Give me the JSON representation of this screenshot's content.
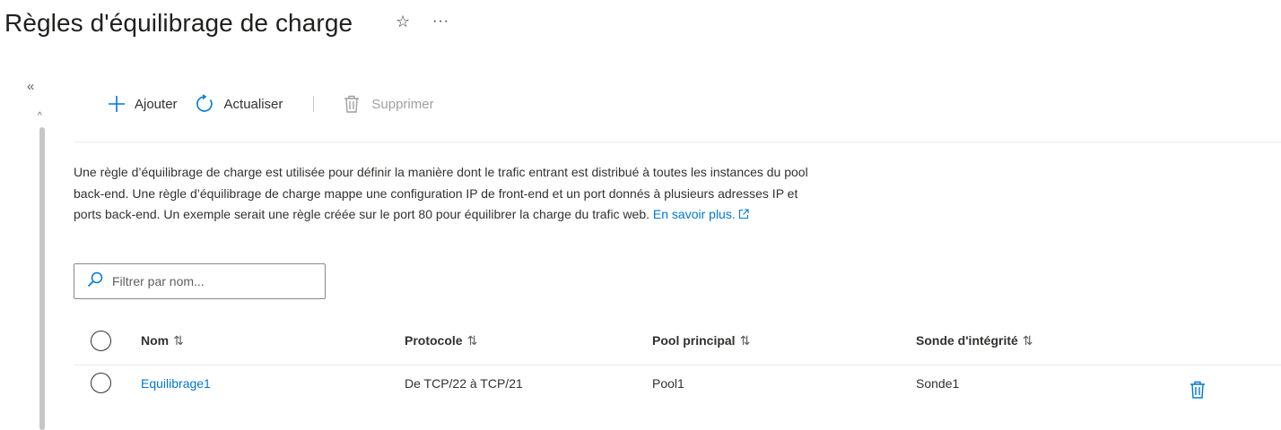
{
  "header": {
    "title": "Règles d'équilibrage de charge",
    "favorite_icon": "star-icon",
    "more_icon": "more-icon"
  },
  "toolbar": {
    "add_label": "Ajouter",
    "refresh_label": "Actualiser",
    "delete_label": "Supprimer"
  },
  "description": {
    "text": "Une règle d’équilibrage de charge est utilisée pour définir la manière dont le trafic entrant est distribué à toutes les instances du pool back-end. Une règle d’équilibrage de charge mappe une configuration IP de front-end et un port donnés à plusieurs adresses IP et ports back-end. Un exemple serait une règle créée sur le port 80 pour équilibrer la charge du trafic web.",
    "link_label": "En savoir plus."
  },
  "filter": {
    "placeholder": "Filtrer par nom..."
  },
  "table": {
    "columns": [
      "Nom",
      "Protocole",
      "Pool principal",
      "Sonde d'intégrité"
    ],
    "rows": [
      {
        "name": "Equilibrage1",
        "protocol": "De TCP/22 à TCP/21",
        "pool": "Pool1",
        "probe": "Sonde1"
      }
    ]
  },
  "colors": {
    "accent": "#0078d4",
    "text": "#323130",
    "disabled": "#a19f9d"
  }
}
